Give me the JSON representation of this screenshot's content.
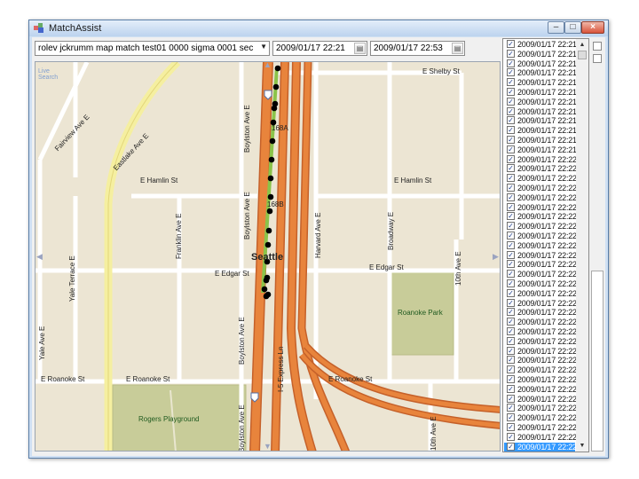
{
  "window": {
    "title": "MatchAssist"
  },
  "toolbar": {
    "trace_select": "rolev jckrumm map match test01 0000 sigma 0001 sec",
    "start_time": "2009/01/17 22:21",
    "end_time": "2009/01/17 22:53"
  },
  "map": {
    "city_label": "Seattle",
    "park_labels": [
      "Roanoke Park",
      "Rogers Playground"
    ],
    "logo": "Live Search",
    "street_labels": {
      "shelby": "E Shelby St",
      "hamlin_w": "E Hamlin St",
      "hamlin_e": "E Hamlin St",
      "edgar_w": "E Edgar St",
      "edgar_e": "E Edgar St",
      "roanoke_w": "E Roanoke St",
      "roanoke_m": "E Roanoke St",
      "roanoke_e": "E Roanoke St",
      "fairview": "Fairview Ave E",
      "eastlake_diag": "Eastlake Ave E",
      "eastlake": "Eastlake Ave E",
      "yale_terrace": "Yale Terrace E",
      "yale": "Yale Ave E",
      "franklin": "Franklin Ave E",
      "boylston_n": "Boylston Ave E",
      "boylston_m": "Boylston Ave E",
      "boylston_s": "Boylston Ave E",
      "boylston_s2": "Boylston Ave E",
      "harvard": "Harvard Ave E",
      "broadway": "Broadway E",
      "tenth": "10th Ave E",
      "tenth_s": "10th Ave E",
      "express": "I-5 Express Ln",
      "exit_a": "168A",
      "exit_b": "168B"
    },
    "shields": [
      "5",
      "5"
    ]
  },
  "timestamps": {
    "rows": [
      "2009/01/17 22:21",
      "2009/01/17 22:21",
      "2009/01/17 22:21",
      "2009/01/17 22:21",
      "2009/01/17 22:21",
      "2009/01/17 22:21",
      "2009/01/17 22:21",
      "2009/01/17 22:21",
      "2009/01/17 22:21",
      "2009/01/17 22:21",
      "2009/01/17 22:21",
      "2009/01/17 22:21",
      "2009/01/17 22:22",
      "2009/01/17 22:22",
      "2009/01/17 22:22",
      "2009/01/17 22:22",
      "2009/01/17 22:22",
      "2009/01/17 22:22",
      "2009/01/17 22:22",
      "2009/01/17 22:22",
      "2009/01/17 22:22",
      "2009/01/17 22:22",
      "2009/01/17 22:22",
      "2009/01/17 22:22",
      "2009/01/17 22:22",
      "2009/01/17 22:22",
      "2009/01/17 22:22",
      "2009/01/17 22:22",
      "2009/01/17 22:22",
      "2009/01/17 22:22",
      "2009/01/17 22:22",
      "2009/01/17 22:22",
      "2009/01/17 22:22",
      "2009/01/17 22:22",
      "2009/01/17 22:22",
      "2009/01/17 22:22",
      "2009/01/17 22:22",
      "2009/01/17 22:22",
      "2009/01/17 22:22",
      "2009/01/17 22:22",
      "2009/01/17 22:22",
      "2009/01/17 22:22",
      "2009/01/17 22:22"
    ],
    "selected_index": 42
  },
  "colors": {
    "highway": "#e8843c",
    "highway_edge": "#c5612a",
    "arterial": "#f5efa0",
    "street": "#ffffff",
    "park": "#c8cc99",
    "matched_route": "#8bc34a",
    "gps_point": "#000000",
    "selection": "#3399ff"
  }
}
